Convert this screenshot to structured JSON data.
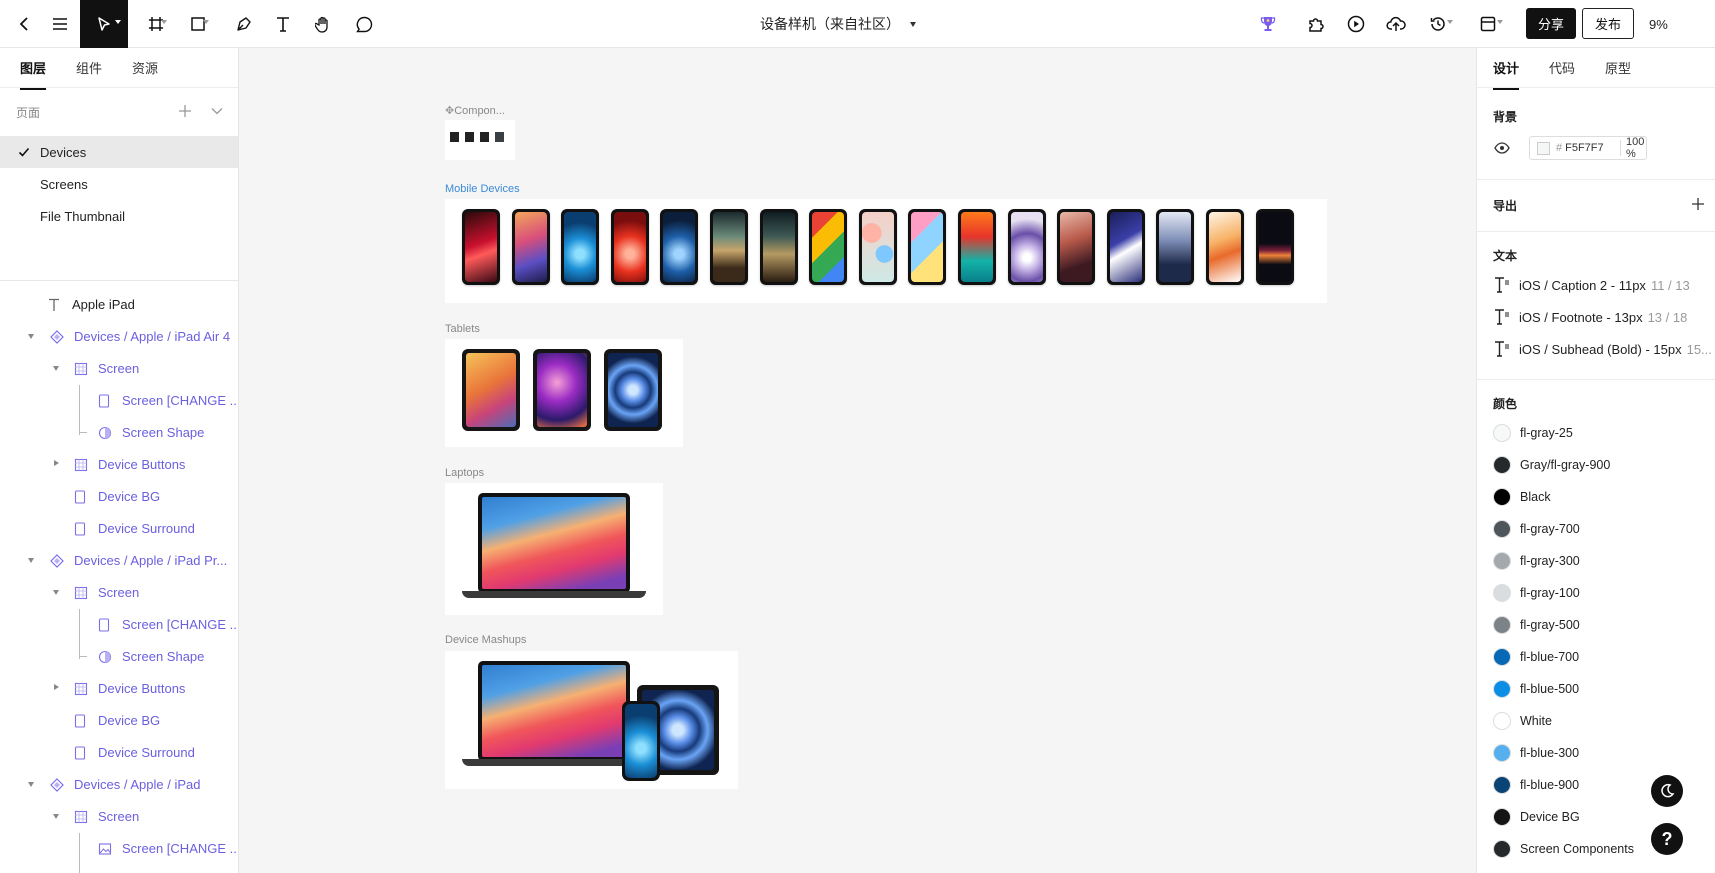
{
  "toolbar": {
    "doc_title": "设备样机（来自社区）",
    "share_label": "分享",
    "publish_label": "发布",
    "zoom": "9%"
  },
  "left": {
    "tabs": [
      "图层",
      "组件",
      "资源"
    ],
    "pages_label": "页面",
    "pages": [
      "Devices",
      "Screens",
      "File Thumbnail"
    ],
    "layers": [
      {
        "label": "Apple iPad",
        "icon": "text-icon"
      },
      {
        "label": "Devices / Apple / iPad Air 4",
        "icon": "component-icon"
      },
      {
        "label": "Screen",
        "icon": "frame-icon"
      },
      {
        "label": "Screen [CHANGE ...",
        "icon": "rect-icon"
      },
      {
        "label": "Screen Shape",
        "icon": "mask-icon"
      },
      {
        "label": "Device Buttons",
        "icon": "frame-icon"
      },
      {
        "label": "Device BG",
        "icon": "rect-icon"
      },
      {
        "label": "Device Surround",
        "icon": "rect-icon"
      },
      {
        "label": "Devices / Apple / iPad Pr...",
        "icon": "component-icon"
      },
      {
        "label": "Screen",
        "icon": "frame-icon"
      },
      {
        "label": "Screen [CHANGE ...",
        "icon": "rect-icon"
      },
      {
        "label": "Screen Shape",
        "icon": "mask-icon"
      },
      {
        "label": "Device Buttons",
        "icon": "frame-icon"
      },
      {
        "label": "Device BG",
        "icon": "rect-icon"
      },
      {
        "label": "Device Surround",
        "icon": "rect-icon"
      },
      {
        "label": "Devices / Apple / iPad",
        "icon": "component-icon"
      },
      {
        "label": "Screen",
        "icon": "frame-icon"
      },
      {
        "label": "Screen [CHANGE ...",
        "icon": "image-icon"
      }
    ]
  },
  "canvas": {
    "components_label": "Compon...",
    "mobile_label": "Mobile Devices",
    "tablets_label": "Tablets",
    "laptops_label": "Laptops",
    "mashups_label": "Device Mashups"
  },
  "right": {
    "tabs": [
      "设计",
      "代码",
      "原型"
    ],
    "bg_title": "背景",
    "bg_hex": "F5F7F7",
    "bg_opacity": "100 %",
    "export_title": "导出",
    "text_title": "文本",
    "text_styles": [
      {
        "name": "iOS / Caption 2 - 11px",
        "dim": "11 / 13"
      },
      {
        "name": "iOS / Footnote - 13px",
        "dim": "13 / 18"
      },
      {
        "name": "iOS / Subhead (Bold) - 15px",
        "dim": "15..."
      }
    ],
    "color_title": "颜色",
    "colors": [
      {
        "name": "fl-gray-25",
        "hex": "#f7f8f8"
      },
      {
        "name": "Gray/fl-gray-900",
        "hex": "#25292c"
      },
      {
        "name": "Black",
        "hex": "#000000"
      },
      {
        "name": "fl-gray-700",
        "hex": "#4e565b"
      },
      {
        "name": "fl-gray-300",
        "hex": "#a3a9ad"
      },
      {
        "name": "fl-gray-100",
        "hex": "#dadddf"
      },
      {
        "name": "fl-gray-500",
        "hex": "#7b8388"
      },
      {
        "name": "fl-blue-700",
        "hex": "#0768b6"
      },
      {
        "name": "fl-blue-500",
        "hex": "#0d8ee6"
      },
      {
        "name": "White",
        "hex": "#ffffff"
      },
      {
        "name": "fl-blue-300",
        "hex": "#56b0ee"
      },
      {
        "name": "fl-blue-900",
        "hex": "#0a4476"
      },
      {
        "name": "Device BG",
        "hex": "#151515"
      },
      {
        "name": "Screen Components",
        "hex": "#26292b"
      }
    ]
  }
}
